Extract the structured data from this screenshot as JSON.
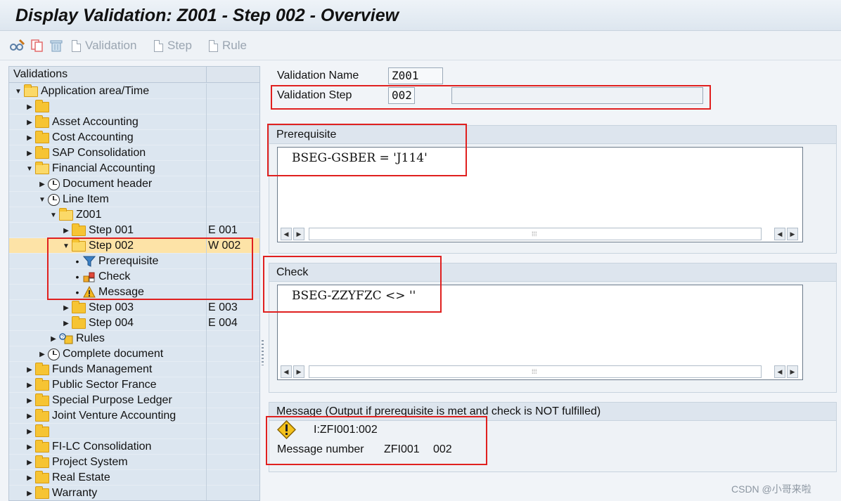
{
  "window": {
    "title": "Display Validation: Z001 - Step 002 - Overview"
  },
  "toolbar": {
    "validation_label": "Validation",
    "step_label": "Step",
    "rule_label": "Rule"
  },
  "tree": {
    "header": "Validations",
    "rows": [
      {
        "label": "Application area/Time",
        "value": ""
      },
      {
        "label": "",
        "value": ""
      },
      {
        "label": "Asset Accounting",
        "value": ""
      },
      {
        "label": "Cost Accounting",
        "value": ""
      },
      {
        "label": "SAP Consolidation",
        "value": ""
      },
      {
        "label": "Financial Accounting",
        "value": ""
      },
      {
        "label": "Document header",
        "value": ""
      },
      {
        "label": "Line Item",
        "value": ""
      },
      {
        "label": "Z001",
        "value": ""
      },
      {
        "label": "Step 001",
        "value": "E 001"
      },
      {
        "label": "Step 002",
        "value": "W 002"
      },
      {
        "label": "Prerequisite",
        "value": ""
      },
      {
        "label": "Check",
        "value": ""
      },
      {
        "label": "Message",
        "value": ""
      },
      {
        "label": "Step 003",
        "value": "E 003"
      },
      {
        "label": "Step 004",
        "value": "E 004"
      },
      {
        "label": "Rules",
        "value": ""
      },
      {
        "label": "Complete document",
        "value": ""
      },
      {
        "label": "Funds Management",
        "value": ""
      },
      {
        "label": "Public Sector France",
        "value": ""
      },
      {
        "label": "Special Purpose Ledger",
        "value": ""
      },
      {
        "label": "Joint Venture Accounting",
        "value": ""
      },
      {
        "label": "",
        "value": ""
      },
      {
        "label": "FI-LC Consolidation",
        "value": ""
      },
      {
        "label": "Project System",
        "value": ""
      },
      {
        "label": "Real Estate",
        "value": ""
      },
      {
        "label": "Warranty",
        "value": ""
      }
    ]
  },
  "detail": {
    "validation_name_label": "Validation Name",
    "validation_name_value": "Z001",
    "validation_step_label": "Validation Step",
    "validation_step_value": "002",
    "validation_step_text": "",
    "prerequisite": {
      "title": "Prerequisite",
      "code": "BSEG-GSBER = 'J114'"
    },
    "check": {
      "title": "Check",
      "code": "BSEG-ZZYFZC <> ''"
    },
    "message": {
      "title": "Message (Output if prerequisite is met and check is NOT fulfilled)",
      "id": "I:ZFI001:002",
      "number_label": "Message number",
      "msg_class": "ZFI001",
      "msg_no": "002"
    }
  },
  "watermark": "CSDN @小哥来啦",
  "colors": {
    "highlight_box": "#e0201f",
    "selected_row": "#fde3a7",
    "folder": "#f6c433"
  }
}
